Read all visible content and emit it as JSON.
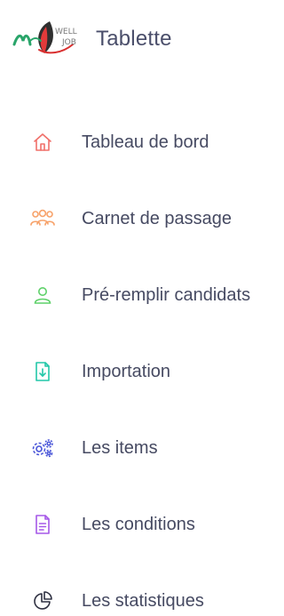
{
  "brand": {
    "title": "Tablette",
    "logo_text_top": "WELL",
    "logo_text_bottom": "JOB"
  },
  "nav": {
    "items": [
      {
        "label": "Tableau de bord",
        "icon": "home-icon",
        "color": "#f0706a"
      },
      {
        "label": "Carnet de passage",
        "icon": "users-icon",
        "color": "#f7a26a"
      },
      {
        "label": "Pré-remplir candidats",
        "icon": "user-icon",
        "color": "#5fd16a"
      },
      {
        "label": "Importation",
        "icon": "file-import-icon",
        "color": "#22c7a8"
      },
      {
        "label": "Les items",
        "icon": "gears-icon",
        "color": "#4a56d8"
      },
      {
        "label": "Les conditions",
        "icon": "document-icon",
        "color": "#a558e8"
      },
      {
        "label": "Les statistiques",
        "icon": "pie-chart-icon",
        "color": "#2f3142"
      }
    ]
  }
}
